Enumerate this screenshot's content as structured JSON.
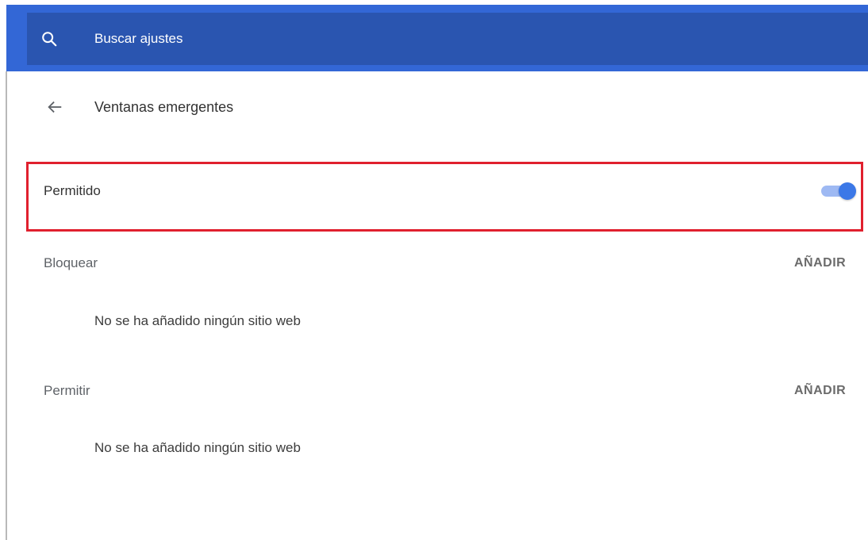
{
  "search": {
    "placeholder": "Buscar ajustes",
    "icon": "search-icon"
  },
  "page": {
    "title": "Ventanas emergentes",
    "back_icon": "arrow-left-icon"
  },
  "main_toggle": {
    "label": "Permitido",
    "enabled": true
  },
  "sections": {
    "block": {
      "title": "Bloquear",
      "add_label": "AÑADIR",
      "empty_text": "No se ha añadido ningún sitio web"
    },
    "allow": {
      "title": "Permitir",
      "add_label": "AÑADIR",
      "empty_text": "No se ha añadido ningún sitio web"
    }
  },
  "colors": {
    "header_bg": "#3367d6",
    "search_bg": "#2a55b0",
    "highlight_border": "#e0202e",
    "toggle_knob": "#3b78e7",
    "toggle_track": "#9eb9f3"
  }
}
